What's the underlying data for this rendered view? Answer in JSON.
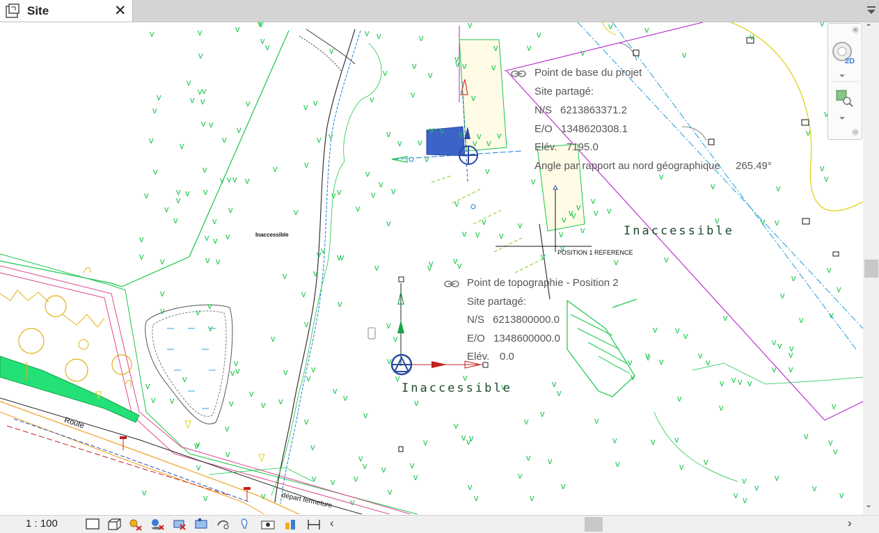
{
  "tab": {
    "title": "Site"
  },
  "view": {
    "survey_marker": "Inaccessible",
    "pond_label_small": "Inaccessible",
    "northeast_label": "Inaccessible",
    "reference_label": "POSITION 1 REFERENCE",
    "road_label": "Route",
    "track_label": "départ fermeture"
  },
  "base_point": {
    "title": "Point de base du projet",
    "shared_label": "Site partagé:",
    "ns_label": "N/S",
    "ns_value": "6213863371.2",
    "eo_label": "E/O",
    "eo_value": "1348620308.1",
    "elev_label": "Elév.",
    "elev_value": "7195.0",
    "angle_label": "Angle par rapport au nord géographique",
    "angle_value": "265.49°"
  },
  "survey_point": {
    "title": "Point de topographie - Position 2",
    "shared_label": "Site partagé:",
    "ns_label": "N/S",
    "ns_value": "6213800000.0",
    "eo_label": "E/O",
    "eo_value": "1348600000.0",
    "elev_label": "Elév.",
    "elev_value": "0.0"
  },
  "status": {
    "scale": "1 : 100"
  },
  "icons": [
    "view-icon",
    "3d-box-icon",
    "sun-path-icon",
    "shadows-icon",
    "crop-icon",
    "show-crop-icon",
    "unlock-3d-icon",
    "temporary-hide-icon",
    "reveal-hidden-icon",
    "analysis-icon",
    "constraints-icon"
  ],
  "colors": {
    "vegetation": "#19c64a",
    "boundary": "#b323c9",
    "contour": "#e0d21a",
    "road": "#f0a020",
    "fill": "#23e077",
    "base_point": "#3d63c8"
  }
}
